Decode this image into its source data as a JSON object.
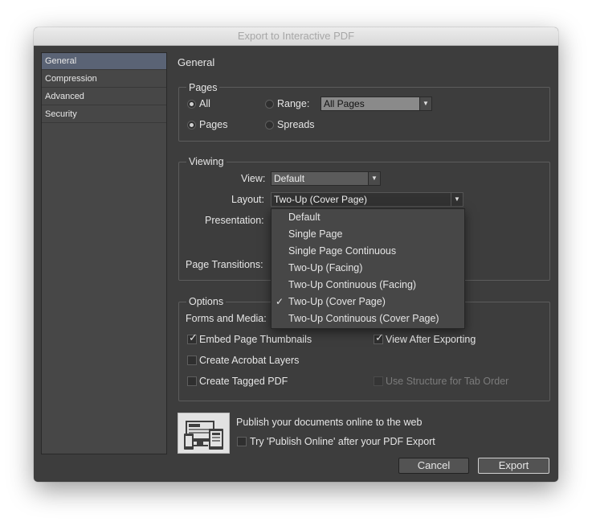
{
  "window": {
    "title": "Export to Interactive PDF"
  },
  "sidebar": {
    "items": [
      {
        "label": "General",
        "active": true
      },
      {
        "label": "Compression",
        "active": false
      },
      {
        "label": "Advanced",
        "active": false
      },
      {
        "label": "Security",
        "active": false
      }
    ]
  },
  "general": {
    "heading": "General"
  },
  "pages": {
    "legend": "Pages",
    "all_label": "All",
    "range_label": "Range:",
    "range_value": "All Pages",
    "pages_label": "Pages",
    "spreads_label": "Spreads",
    "selected_scope": "All",
    "selected_mode": "Pages"
  },
  "viewing": {
    "legend": "Viewing",
    "view_label": "View:",
    "view_value": "Default",
    "layout_label": "Layout:",
    "layout_value": "Two-Up (Cover Page)",
    "presentation_label": "Presentation:",
    "page_transitions_label": "Page Transitions:"
  },
  "layout_menu": {
    "items": [
      {
        "label": "Default",
        "checked": false
      },
      {
        "label": "Single Page",
        "checked": false
      },
      {
        "label": "Single Page Continuous",
        "checked": false
      },
      {
        "label": "Two-Up (Facing)",
        "checked": false
      },
      {
        "label": "Two-Up Continuous (Facing)",
        "checked": false
      },
      {
        "label": "Two-Up (Cover Page)",
        "checked": true
      },
      {
        "label": "Two-Up Continuous (Cover Page)",
        "checked": false
      }
    ],
    "check_glyph": "✓"
  },
  "options": {
    "legend": "Options",
    "forms_label": "Forms and Media:",
    "embed_thumbnails": {
      "label": "Embed Page Thumbnails",
      "checked": true
    },
    "view_after": {
      "label": "View After Exporting",
      "checked": true
    },
    "acrobat_layers": {
      "label": "Create Acrobat Layers",
      "checked": false
    },
    "tagged_pdf": {
      "label": "Create Tagged PDF",
      "checked": false
    },
    "structure_tab": {
      "label": "Use Structure for Tab Order",
      "checked": false,
      "disabled": true
    }
  },
  "publish": {
    "text": "Publish your documents online to the web",
    "try_label": "Try 'Publish Online' after your PDF Export",
    "try_checked": false
  },
  "buttons": {
    "cancel": "Cancel",
    "export": "Export"
  },
  "colors": {
    "window_bg": "#3d3d3d",
    "sidebar_active": "#5a6375",
    "text": "#e6e6e6",
    "disabled_text": "#7b7b7b"
  },
  "icons": {
    "dropdown": "dropdown-arrow-icon",
    "checkmark": "checkmark-icon",
    "publish": "publish-online-icon"
  }
}
